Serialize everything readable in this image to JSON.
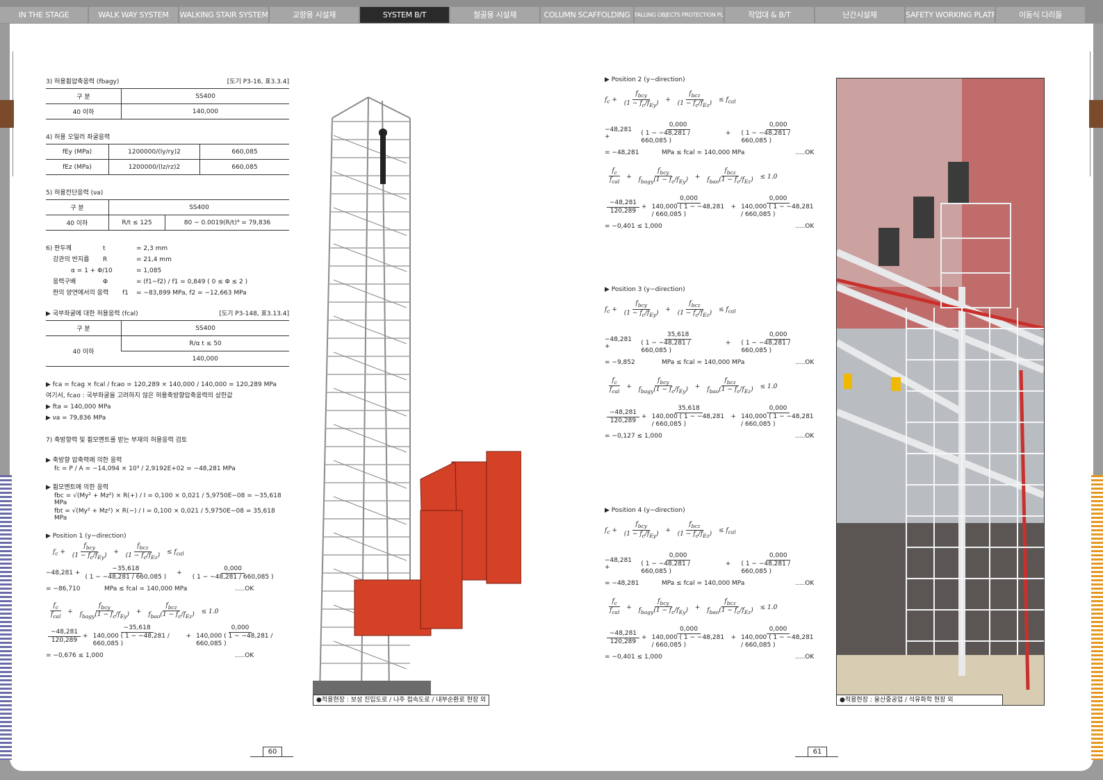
{
  "nav": [
    "IN THE STAGE",
    "WALK WAY SYSTEM",
    "WALKING STAIR SYSTEM",
    "교량용 시설재",
    "SYSTEM B/T",
    "철골용 시설재",
    "COLUMN SCAFFOLDING",
    "FALLING OBJECTS PROTECTION PLATFORM",
    "작업대 & B/T",
    "난간시설재",
    "SAFETY WORKING PLATFORM",
    "이동식 다리들"
  ],
  "active_tab": "SYSTEM B/T",
  "left": {
    "s3": {
      "title": "3) 허용휨압축응력 (fbagy)",
      "ref": "[도기 P3-16, 표3.3.4]",
      "h1": "구 분",
      "h2": "SS400",
      "c1": "40 이하",
      "c2": "140,000"
    },
    "s4": {
      "title": "4) 허용 오일러 좌굴응력",
      "rows": [
        [
          "fEy (MPa)",
          "1200000/(ly/ry)2",
          "660,085"
        ],
        [
          "fEz (MPa)",
          "1200000/(lz/rz)2",
          "660,085"
        ]
      ]
    },
    "s5": {
      "title": "5) 허용전단응력 (νa)",
      "h1": "구 분",
      "h2": "SS400",
      "c1": "40 이하",
      "c2": "R/t ≤ 125",
      "c3": "80 − 0.0019(R/t)⁴  = 79,836"
    },
    "s6": [
      [
        "6) 판두께",
        "t",
        "= 2,3 mm"
      ],
      [
        "강관의 반지름",
        "R",
        "= 21,4 mm"
      ],
      [
        "α = 1 + Φ/10",
        "",
        "= 1,085"
      ],
      [
        "응력구배",
        "Φ",
        "=  (f1−f2) / f1 = 0,849   ( 0 ≤ Φ ≤ 2 )"
      ],
      [
        "판의 양연에서의 응력",
        "f1",
        "= −83,899 MPa,    f2 = −12,663 MPa"
      ]
    ],
    "s7": {
      "title": "▶ 국부좌굴에 대한 허용응력 (fcal)",
      "ref": "[도기 P3-148, 표3.13.4]",
      "h1": "구 분",
      "h2": "SS400",
      "c1": "40 이하",
      "c2": "R/α t ≤ 50",
      "c3": "140,000"
    },
    "notes": [
      "▶  fca      = fcag  ×  fcal  /  fcao     = 120,289   ×  140,000  /  140,000  =  120,289 MPa",
      "    여기서, fcao : 국부좌굴을 고려하지 않은 허용축방향압축응력의 상한값",
      "▶  fta      = 140,000 MPa",
      "▶  νa       = 79,836 MPa"
    ],
    "s8": "7) 축방향력 및 휨모멘트를 받는 부재의 허용응력 검토",
    "axial_h": "▶  축방향 압축력에 의한 응력",
    "axial": "fc       = P / A =  −14,094  ×  10³ / 2,9192E+02 = −48,281  MPa",
    "bend_h": "▶  휨모멘트에 의한 응력",
    "bend1": "fbc = √(My² + Mz²) × R(+) / I  = 0,100 × 0,021 / 5,9750E−08 = −35,618 MPa",
    "bend2": "fbt = √(My² + Mz²) × R(−) / I  = 0,100 × 0,021 / 5,9750E−08 = 35,618 MPa",
    "pos1": {
      "title": "▶  Position 1 (y−direction)",
      "a": "−48,281 +",
      "n1": "−35,618",
      "n2": "0,000",
      "r1": "= −86,710",
      "r1b": "MPa  ≤  fcal = 140,000  MPa",
      "ok": ".....OK",
      "b1": "−48,281",
      "b2": "120,289",
      "bn1": "−35,618",
      "bn2": "0,000",
      "r2": "= −0,676   ≤   1,000"
    }
  },
  "right": {
    "pos": [
      {
        "title": "▶  Position 2 (y−direction)",
        "n1": "0,000",
        "n2": "0,000",
        "r1": "= −48,281",
        "bn1": "0,000",
        "bn2": "0,000",
        "r2": "= −0,401   ≤   1,000"
      },
      {
        "title": "▶  Position 3 (y−direction)",
        "n1": "35,618",
        "n2": "0,000",
        "r1": "= −9,852",
        "bn1": "35,618",
        "bn2": "0,000",
        "r2": "= −0,127   ≤   1,000"
      },
      {
        "title": "▶  Position 4 (y−direction)",
        "n1": "0,000",
        "n2": "0,000",
        "r1": "= −48,281",
        "bn1": "0,000",
        "bn2": "0,000",
        "r2": "= −0,401   ≤   1,000"
      }
    ],
    "fc": "−48,281 +",
    "fcal": "MPa  ≤  fcal = 140,000  MPa",
    "ok": ".....OK",
    "fe": "660,085",
    "fem": "−48,281",
    "b1": "−48,281",
    "b2": "120,289",
    "c140": "140,000 ( 1 −"
  },
  "captions": {
    "left": "●적용현장 :  보성 진입도로 / 나주 접속도로 / 내부순환로 현장 외",
    "right": "●적용현장 : 울산중공업 / 석유화학 현장 외"
  },
  "pages": {
    "left": "60",
    "right": "61"
  }
}
